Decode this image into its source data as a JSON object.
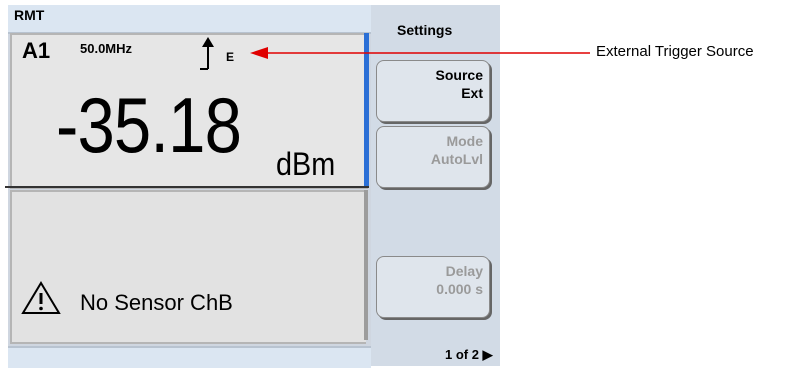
{
  "status": {
    "remote": "RMT"
  },
  "measurement": {
    "channel": "A1",
    "frequency": "50.0MHz",
    "trigger_indicator": "E",
    "value": "-35.18",
    "unit": "dBm"
  },
  "message": {
    "text": "No Sensor ChB",
    "icon": "warning-triangle-icon"
  },
  "menu": {
    "title": "Settings",
    "softkeys": [
      {
        "line1": "Source",
        "line2": "Ext",
        "state": "active"
      },
      {
        "line1": "Mode",
        "line2": "AutoLvl",
        "state": "dimmed"
      },
      {
        "line1": "Delay",
        "line2": "0.000 s",
        "state": "dimmed"
      }
    ],
    "page": "1 of 2 ▶"
  },
  "annotation": {
    "label": "External Trigger Source"
  },
  "colors": {
    "accent": "#2a6fd6",
    "callout": "#e00000",
    "panel": "#cfd6e0"
  }
}
